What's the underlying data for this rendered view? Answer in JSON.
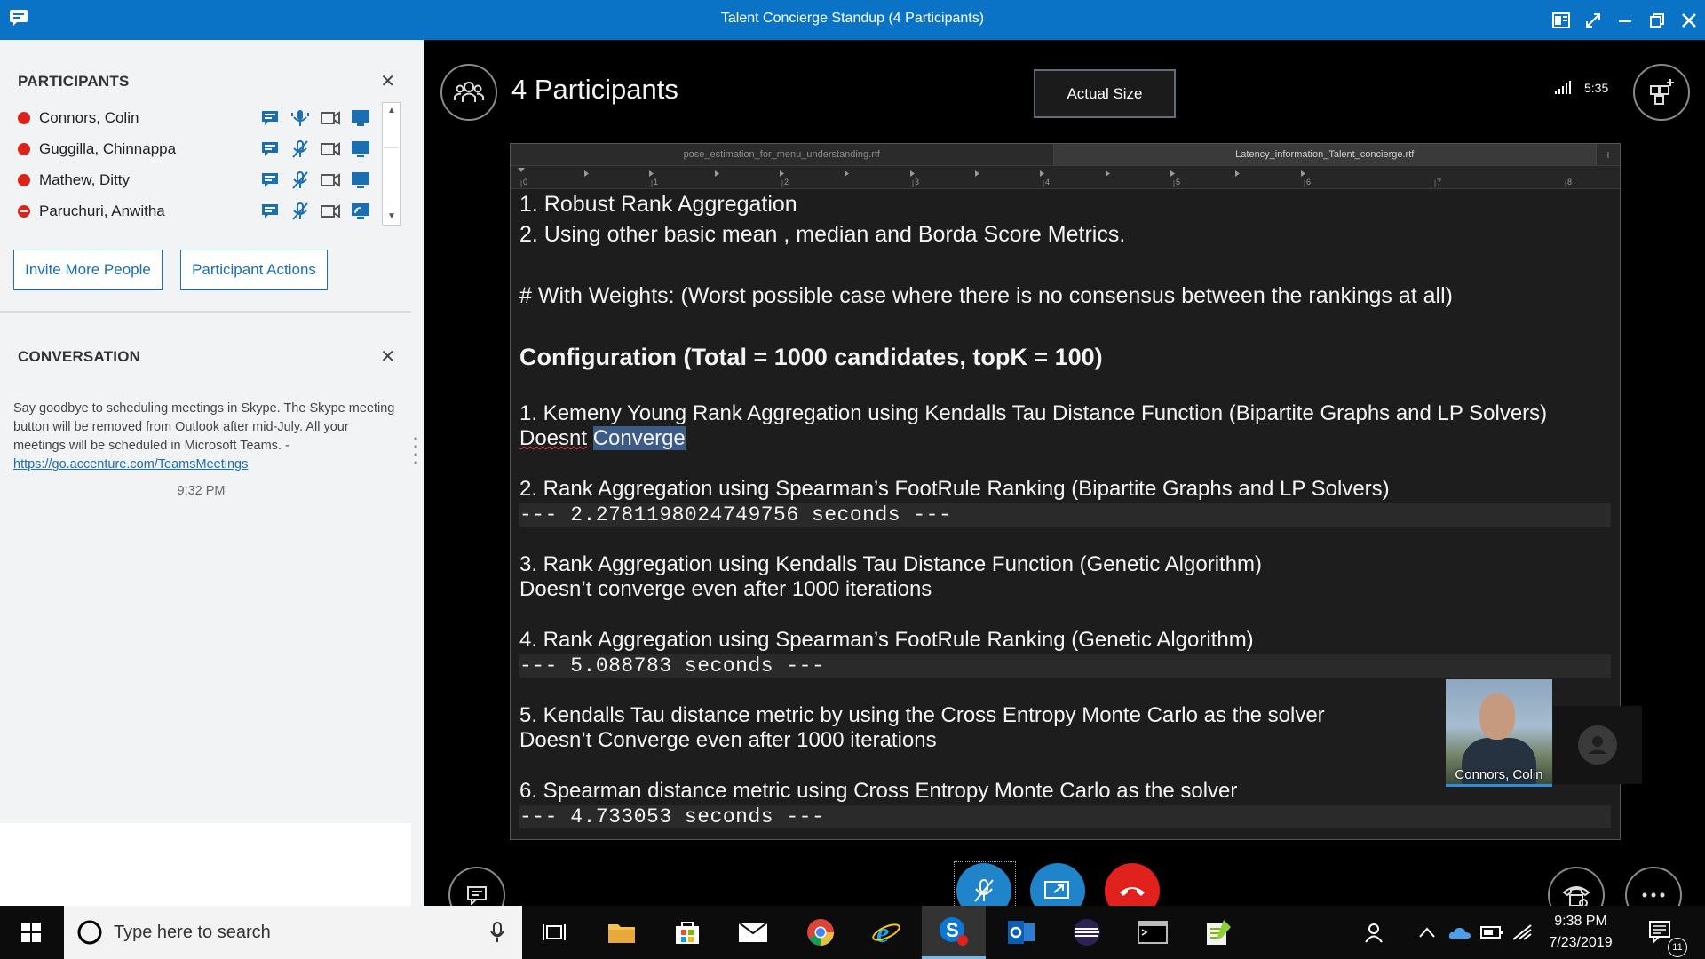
{
  "window": {
    "title": "Talent Concierge Standup (4 Participants)"
  },
  "participants": {
    "heading": "PARTICIPANTS",
    "items": [
      {
        "name": "Connors, Colin"
      },
      {
        "name": "Guggilla, Chinnappa"
      },
      {
        "name": "Mathew, Ditty"
      },
      {
        "name": "Paruchuri, Anwitha"
      }
    ],
    "invite_label": "Invite More People",
    "actions_label": "Participant Actions"
  },
  "conversation": {
    "heading": "CONVERSATION",
    "message": "Say goodbye to scheduling meetings in Skype. The Skype meeting button will be removed from Outlook after mid-July. All your meetings will be scheduled in Microsoft Teams. -",
    "link": "https://go.accenture.com/TeamsMeetings",
    "time": "9:32 PM"
  },
  "stage": {
    "participants_title": "4 Participants",
    "actual_size_label": "Actual Size",
    "duration": "5:35",
    "self_view_name": "Connors, Colin"
  },
  "document": {
    "tabs": [
      "pose_estimation_for_menu_understanding.rtf",
      "Latency_information_Talent_concierge.rtf"
    ],
    "ruler_numbers": [
      "0",
      "1",
      "2",
      "3",
      "4",
      "5",
      "6",
      "7",
      "8"
    ],
    "lines": {
      "l1": "1. Robust Rank Aggregation",
      "l2": "2. Using other basic mean , median and Borda Score Metrics.",
      "l3": "# With Weights: (Worst possible case where there is no consensus between the rankings at all)",
      "l4": "Configuration (Total = 1000 candidates, topK = 100)",
      "l5": "1. Kemeny Young Rank Aggregation using Kendalls Tau Distance Function (Bipartite Graphs and LP Solvers)",
      "l6a": "Doesnt",
      "l6b": "Converge",
      "l7": "2. Rank Aggregation using Spearman’s FootRule Ranking (Bipartite Graphs and LP Solvers)",
      "l8": "--- 2.2781198024749756 seconds ---",
      "l9": "3. Rank Aggregation using Kendalls Tau Distance Function (Genetic Algorithm)",
      "l10": "Doesn’t converge even after 1000 iterations",
      "l11": "4. Rank Aggregation using Spearman’s FootRule Ranking (Genetic Algorithm)",
      "l12": "--- 5.088783 seconds ---",
      "l13": "5. Kendalls Tau distance metric by using the Cross Entropy Monte Carlo as the solver",
      "l14": "Doesn’t Converge even after 1000 iterations",
      "l15": "6. Spearman distance metric using Cross Entropy Monte Carlo as the solver",
      "l16": "--- 4.733053 seconds ---"
    }
  },
  "taskbar": {
    "search_placeholder": "Type here to search",
    "time": "9:38 PM",
    "date": "7/23/2019",
    "notification_count": "11"
  },
  "colors": {
    "titlebar": "#0a73c5",
    "accent": "#1a6fb3",
    "presence_busy": "#d9241b",
    "hangup": "#e0211c",
    "call_blue": "#1f84c9"
  }
}
